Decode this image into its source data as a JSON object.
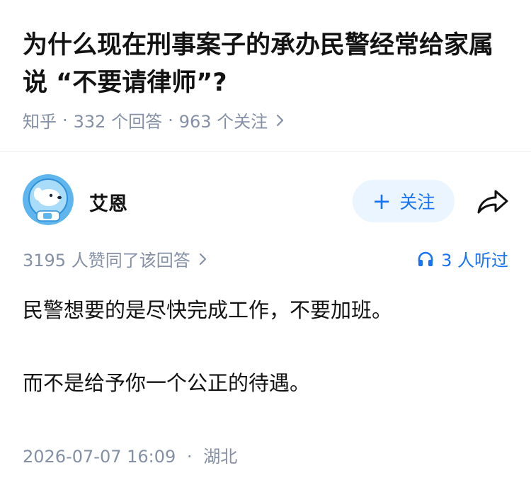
{
  "question": {
    "title": "为什么现在刑事案子的承办民警经常给家属说 “不要请律师”?",
    "source": "知乎",
    "answer_count": "332 个回答",
    "follower_count": "963 个关注"
  },
  "author": {
    "name": "艾恩",
    "follow_label": "关注",
    "avatar_icon": "astronaut-dog-avatar"
  },
  "stats": {
    "likes_text": "3195 人赞同了该回答",
    "listen_text": "3 人听过"
  },
  "answer": {
    "paragraphs": [
      "民警想要的是尽快完成工作，不要加班。",
      "而不是给予你一个公正的待遇。"
    ]
  },
  "footer": {
    "date": "2026-07-07 16:09",
    "location": "湖北"
  },
  "colors": {
    "accent": "#1772f6",
    "follow_bg": "#ebf5ff",
    "muted": "#8590a6",
    "text": "#121212"
  }
}
